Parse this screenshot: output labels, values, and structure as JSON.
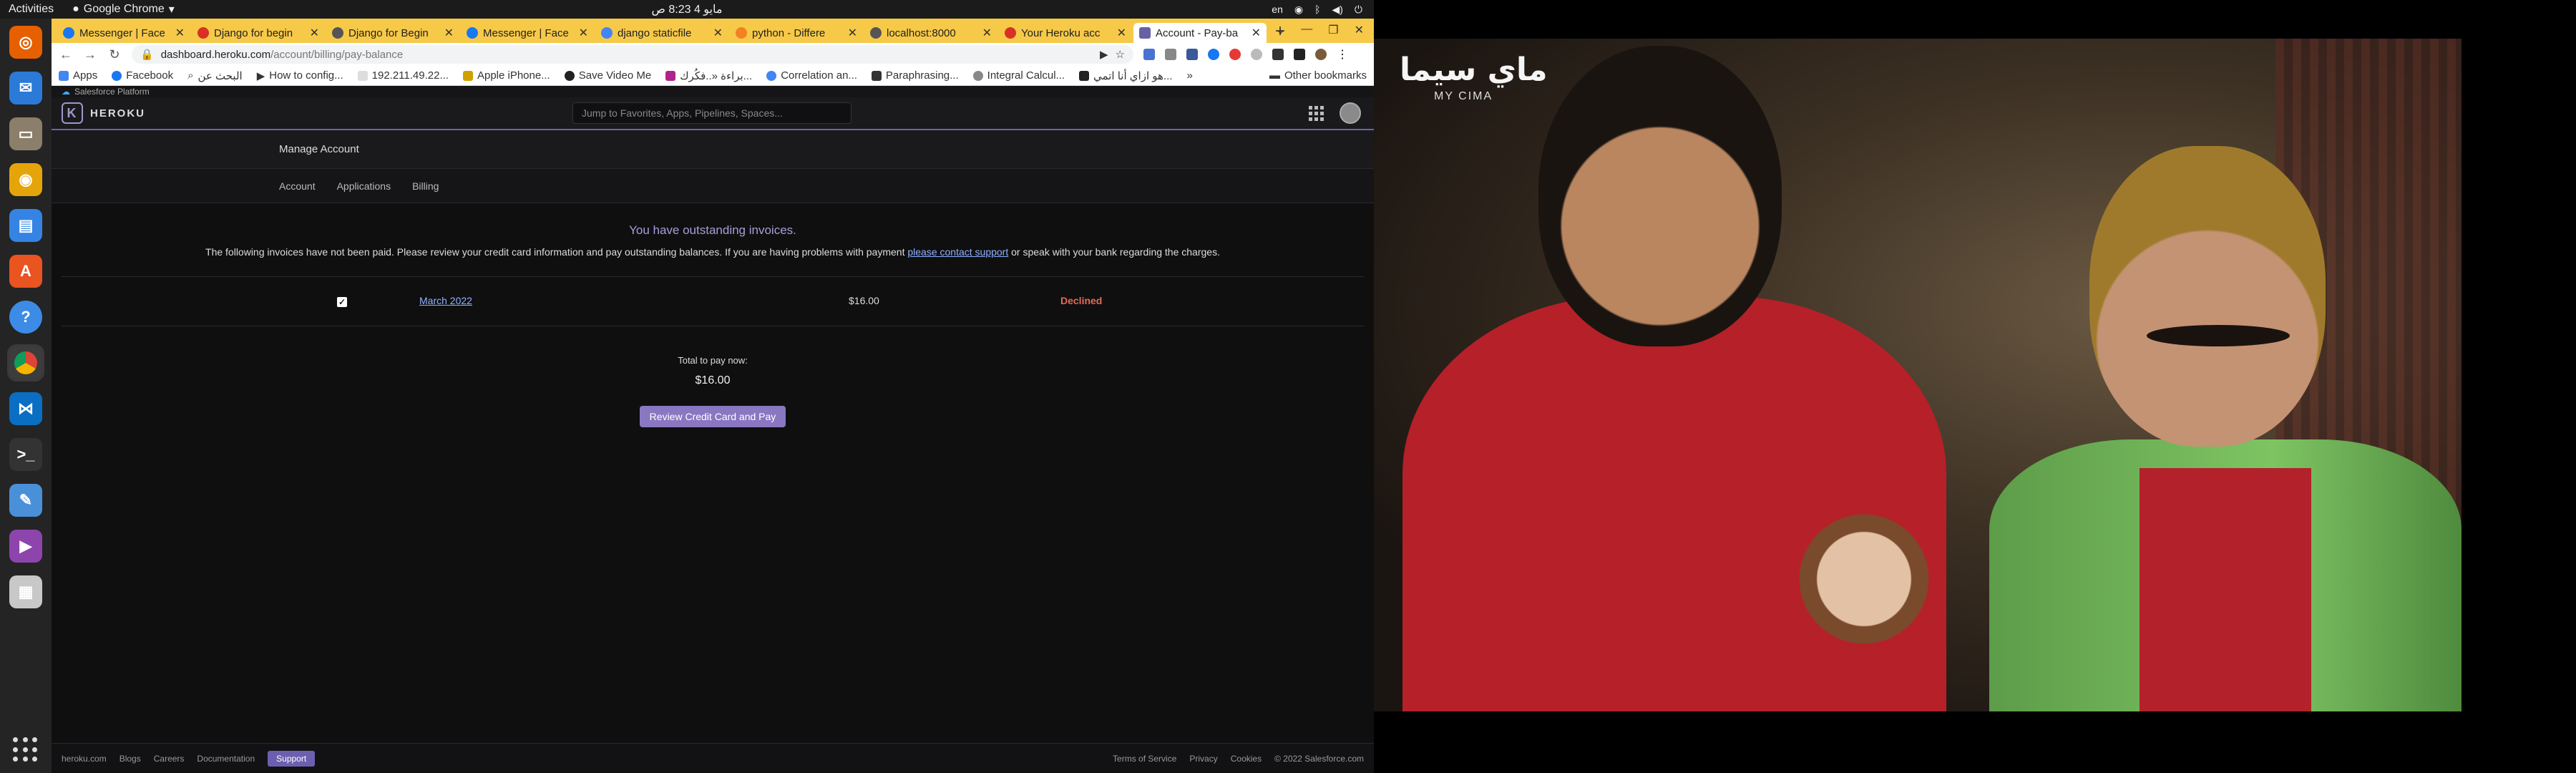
{
  "desktop": {
    "activities": "Activities",
    "app_name": "Google Chrome",
    "clock": "مايو 4  8:23 ص",
    "lang": "en"
  },
  "browser": {
    "tabs": [
      {
        "label": "Messenger | Face",
        "color": "#1877f2"
      },
      {
        "label": "Django for begin",
        "color": "#d93025"
      },
      {
        "label": "Django for Begin",
        "color": "#555555"
      },
      {
        "label": "Messenger | Face",
        "color": "#1877f2"
      },
      {
        "label": "django staticfile",
        "color": "#4285f4"
      },
      {
        "label": "python - Differe",
        "color": "#f48024"
      },
      {
        "label": "localhost:8000",
        "color": "#555555"
      },
      {
        "label": "Your Heroku acc",
        "color": "#d93025"
      },
      {
        "label": "Account - Pay-ba",
        "color": "#6762a6"
      }
    ],
    "url_host": "dashboard.heroku.com",
    "url_path": "/account/billing/pay-balance",
    "bookmarks": [
      {
        "label": "Apps",
        "color": "#4285f4"
      },
      {
        "label": "Facebook",
        "color": "#1877f2"
      },
      {
        "label": "البحث عن",
        "color": "#999999"
      },
      {
        "label": "How to config...",
        "color": "#333333"
      },
      {
        "label": "192.211.49.22...",
        "color": "#cccccc"
      },
      {
        "label": "Apple iPhone...",
        "color": "#d0a000"
      },
      {
        "label": "Save Video Me",
        "color": "#222222"
      },
      {
        "label": "براءة «..فكُرك...",
        "color": "#b0228c"
      },
      {
        "label": "Correlation an...",
        "color": "#4285f4"
      },
      {
        "label": "Paraphrasing...",
        "color": "#333333"
      },
      {
        "label": "Integral Calcul...",
        "color": "#888888"
      },
      {
        "label": "هو ازاي أنا اتمي...",
        "color": "#222222"
      }
    ],
    "other_bookmarks": "Other bookmarks"
  },
  "heroku": {
    "platform": "Salesforce Platform",
    "brand": "HEROKU",
    "search_placeholder": "Jump to Favorites, Apps, Pipelines, Spaces...",
    "manage_title": "Manage Account",
    "subnav": [
      "Account",
      "Applications",
      "Billing"
    ],
    "alert_title": "You have outstanding invoices.",
    "alert_msg_pre": "The following invoices have not been paid. Please review your credit card information and pay outstanding balances. If you are having problems with payment ",
    "alert_link": "please contact support",
    "alert_msg_post": " or speak with your bank regarding the charges.",
    "invoice": {
      "period": "March 2022",
      "amount": "$16.00",
      "status": "Declined"
    },
    "total_label": "Total to pay now:",
    "total_value": "$16.00",
    "pay_button": "Review Credit Card and Pay",
    "footer_left": [
      "heroku.com",
      "Blogs",
      "Careers",
      "Documentation"
    ],
    "support": "Support",
    "footer_right": [
      "Terms of Service",
      "Privacy",
      "Cookies",
      "© 2022 Salesforce.com"
    ]
  },
  "video": {
    "logo": "ماي سيما",
    "logo_sub": "MY CIMA"
  }
}
